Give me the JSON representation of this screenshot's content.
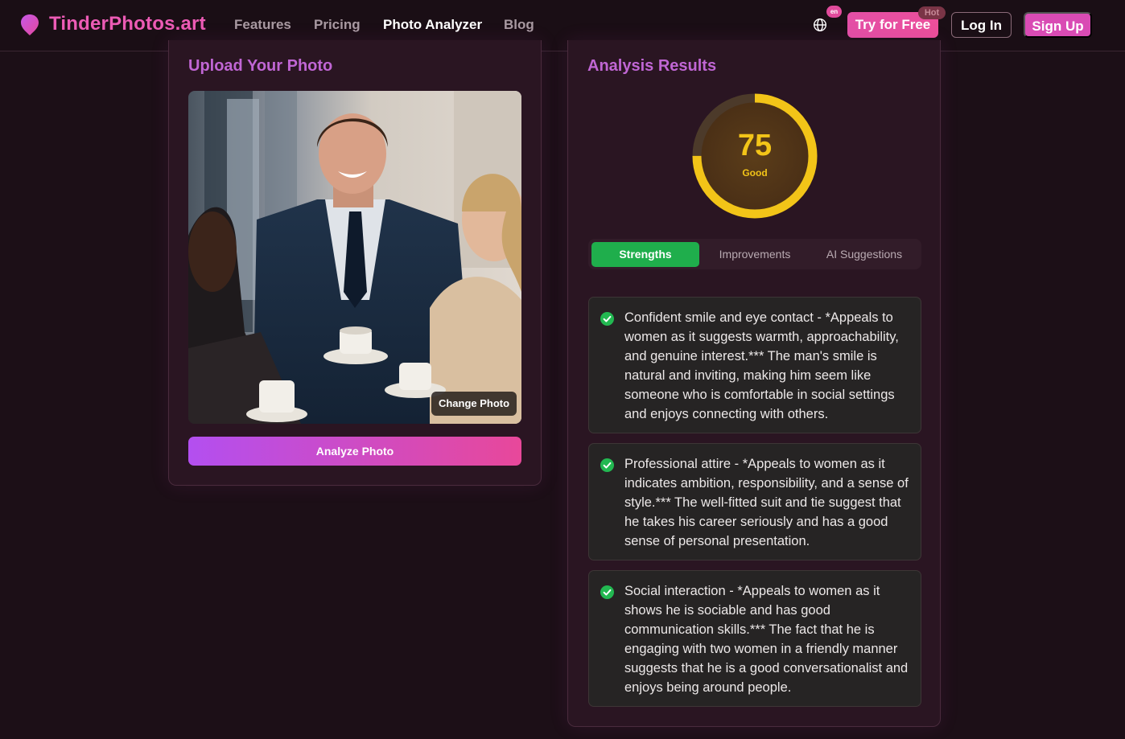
{
  "brand": {
    "name": "TinderPhotos.art",
    "accent": "#ec5bb5"
  },
  "nav": {
    "links": [
      "Features",
      "Pricing",
      "Photo Analyzer",
      "Blog"
    ],
    "active": "Photo Analyzer",
    "language_badge": "en",
    "try_label": "Try for Free",
    "hot_badge": "Hot",
    "login_label": "Log In",
    "signup_label": "Sign Up"
  },
  "upload": {
    "title": "Upload Your Photo",
    "change_label": "Change Photo",
    "analyze_label": "Analyze Photo"
  },
  "results": {
    "title": "Analysis Results",
    "score": {
      "value": "75",
      "max": 100,
      "label": "Good",
      "color": "#f2c418"
    },
    "tabs": [
      "Strengths",
      "Improvements",
      "AI Suggestions"
    ],
    "active_tab": "Strengths",
    "strengths": [
      "Confident smile and eye contact - *Appeals to women as it suggests warmth, approachability, and genuine interest.*** The man's smile is natural and inviting, making him seem like someone who is comfortable in social settings and enjoys connecting with others.",
      "Professional attire - *Appeals to women as it indicates ambition, responsibility, and a sense of style.*** The well-fitted suit and tie suggest that he takes his career seriously and has a good sense of personal presentation.",
      "Social interaction - *Appeals to women as it shows he is sociable and has good communication skills.*** The fact that he is engaging with two women in a friendly manner suggests that he is a good conversationalist and enjoys being around people."
    ]
  }
}
